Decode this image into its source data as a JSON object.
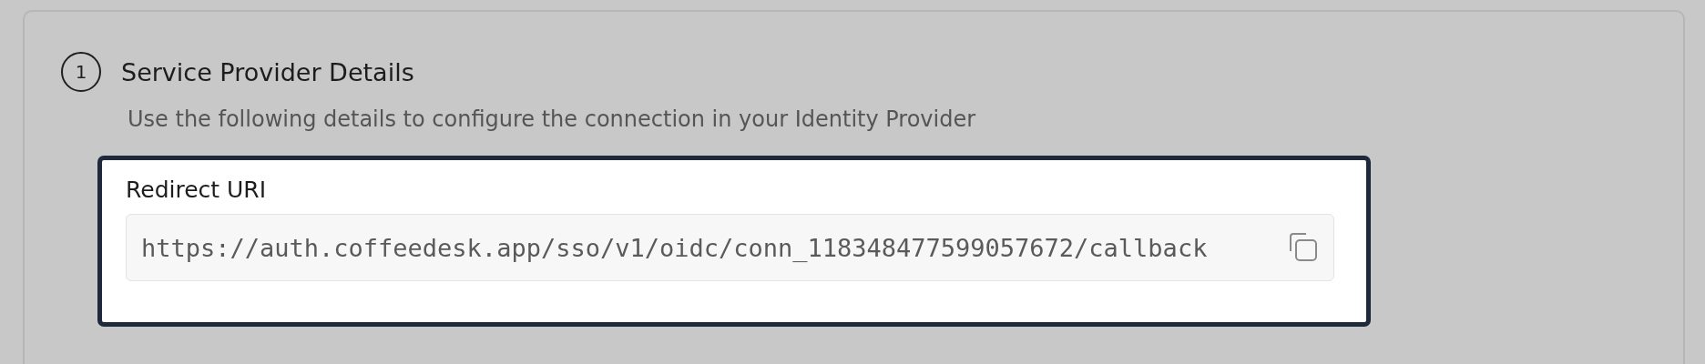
{
  "step": {
    "number": "1",
    "title": "Service Provider Details",
    "description": "Use the following details to configure the connection in your Identity Provider"
  },
  "fields": [
    {
      "label": "Redirect URI",
      "value": "https://auth.coffeedesk.app/sso/v1/oidc/conn_118348477599057672/callback"
    }
  ]
}
